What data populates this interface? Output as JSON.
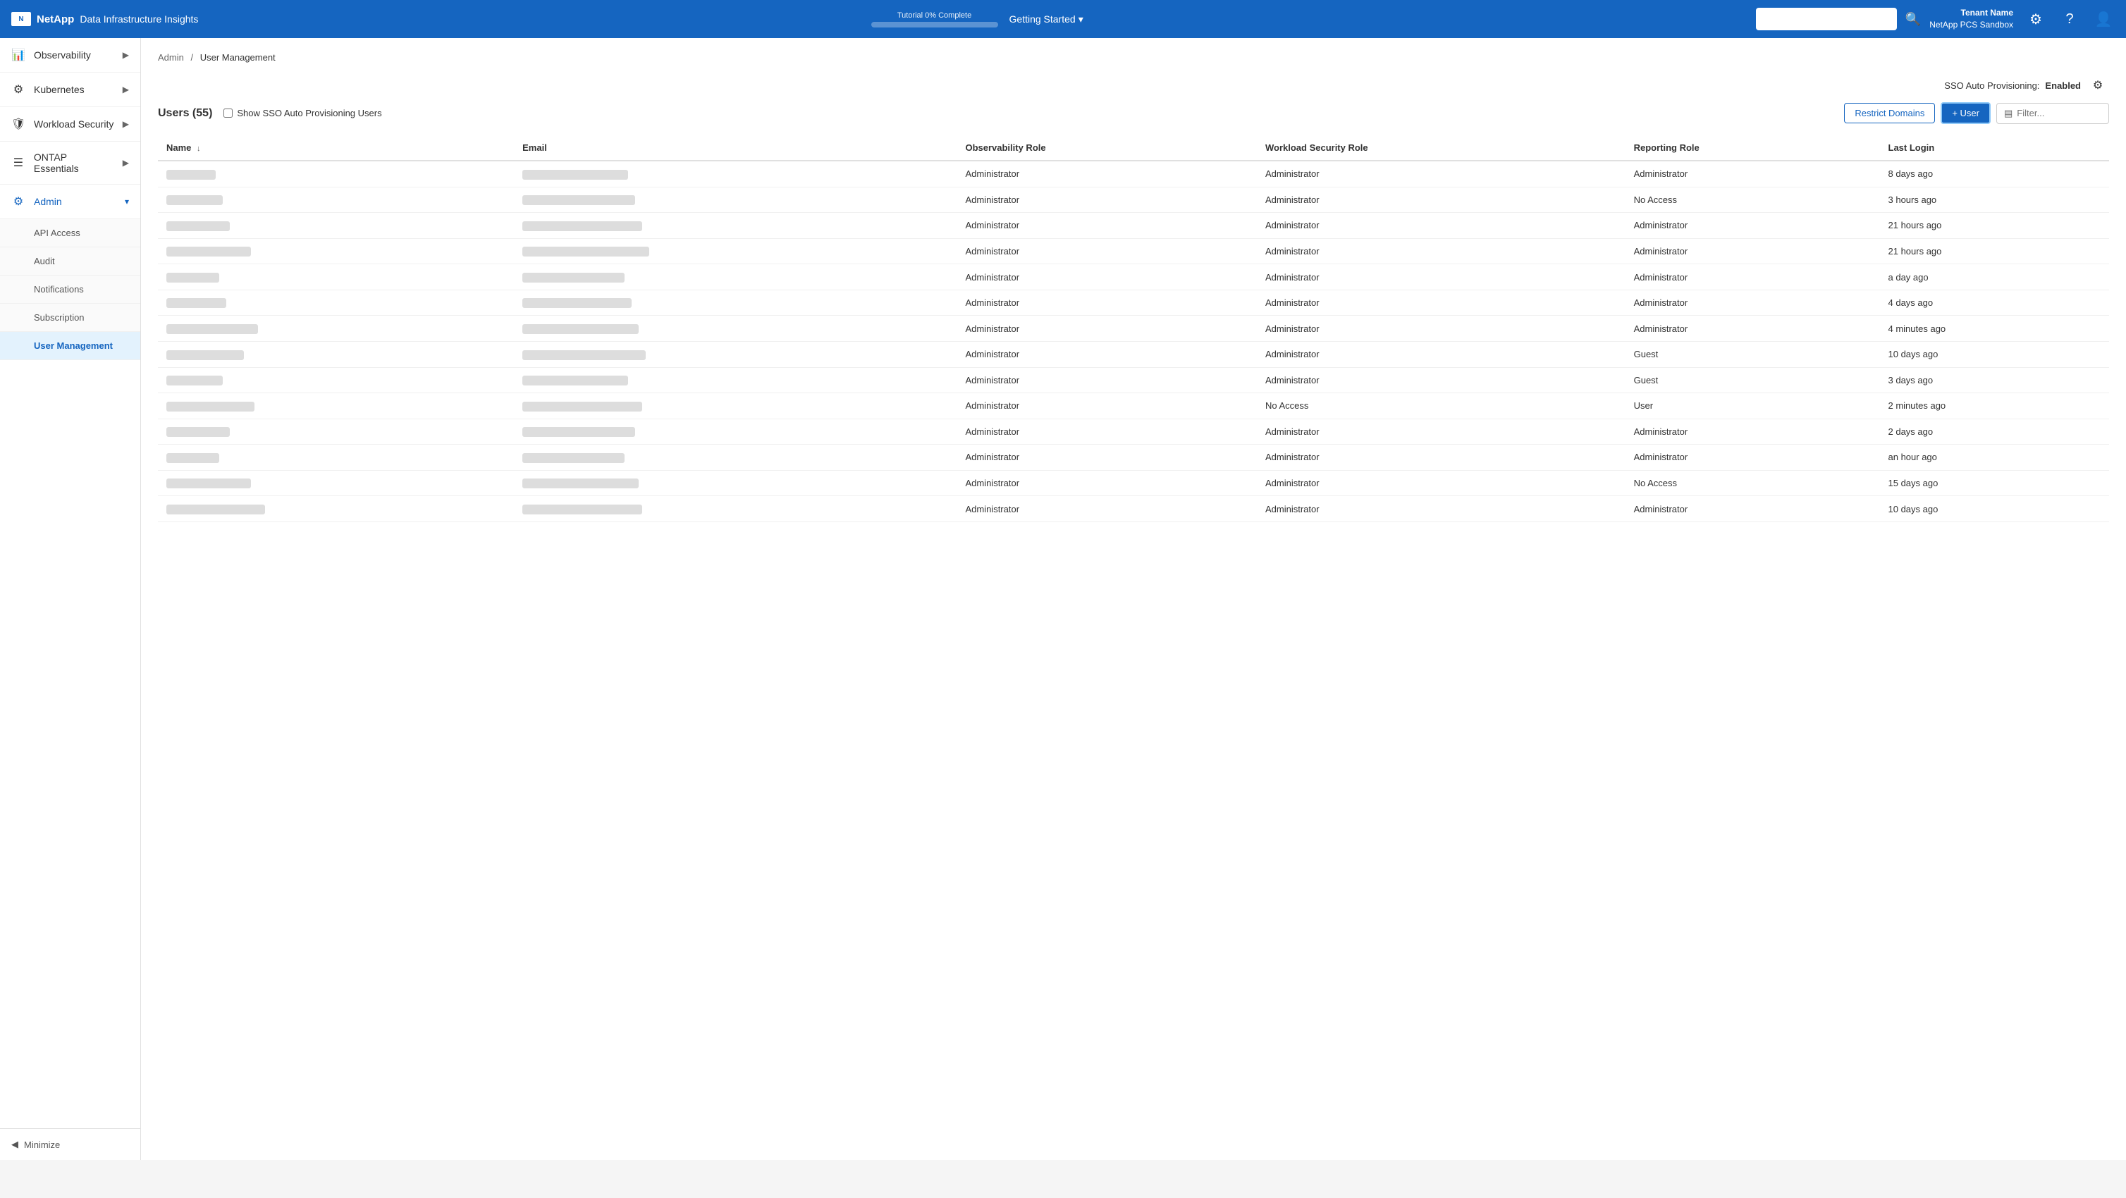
{
  "header": {
    "logo_text": "NetApp",
    "app_name": "Data Infrastructure Insights",
    "tutorial_label": "Tutorial 0% Complete",
    "tutorial_percent": 0,
    "getting_started": "Getting Started",
    "search_placeholder": "",
    "tenant_name": "Tenant Name",
    "tenant_sub": "NetApp PCS Sandbox"
  },
  "sidebar": {
    "items": [
      {
        "id": "observability",
        "label": "Observability",
        "icon": "📊",
        "has_sub": true
      },
      {
        "id": "kubernetes",
        "label": "Kubernetes",
        "icon": "⚙",
        "has_sub": true
      },
      {
        "id": "workload-security",
        "label": "Workload Security",
        "icon": "🛡",
        "has_sub": true
      },
      {
        "id": "ontap-essentials",
        "label": "ONTAP Essentials",
        "icon": "☰",
        "has_sub": true
      },
      {
        "id": "admin",
        "label": "Admin",
        "icon": "⚙",
        "has_sub": true,
        "active": true
      }
    ],
    "sub_items": [
      {
        "id": "api-access",
        "label": "API Access"
      },
      {
        "id": "audit",
        "label": "Audit"
      },
      {
        "id": "notifications",
        "label": "Notifications"
      },
      {
        "id": "subscription",
        "label": "Subscription"
      },
      {
        "id": "user-management",
        "label": "User Management",
        "active": true
      }
    ],
    "minimize": "Minimize"
  },
  "breadcrumb": {
    "parent": "Admin",
    "separator": "/",
    "current": "User Management"
  },
  "sso": {
    "label": "SSO Auto Provisioning:",
    "status": "Enabled",
    "settings_title": "SSO Settings"
  },
  "users_section": {
    "title": "Users",
    "count": 55,
    "show_sso_label": "Show SSO Auto Provisioning Users",
    "restrict_domains": "Restrict Domains",
    "add_user": "+ User",
    "filter_placeholder": "Filter..."
  },
  "table": {
    "columns": [
      "Name",
      "Email",
      "Observability Role",
      "Workload Security Role",
      "Reporting Role",
      "Last Login"
    ],
    "rows": [
      {
        "obs_role": "Administrator",
        "ws_role": "Administrator",
        "rep_role": "Administrator",
        "last_login": "8 days ago"
      },
      {
        "obs_role": "Administrator",
        "ws_role": "Administrator",
        "rep_role": "No Access",
        "last_login": "3 hours ago"
      },
      {
        "obs_role": "Administrator",
        "ws_role": "Administrator",
        "rep_role": "Administrator",
        "last_login": "21 hours ago"
      },
      {
        "obs_role": "Administrator",
        "ws_role": "Administrator",
        "rep_role": "Administrator",
        "last_login": "21 hours ago"
      },
      {
        "obs_role": "Administrator",
        "ws_role": "Administrator",
        "rep_role": "Administrator",
        "last_login": "a day ago"
      },
      {
        "obs_role": "Administrator",
        "ws_role": "Administrator",
        "rep_role": "Administrator",
        "last_login": "4 days ago"
      },
      {
        "obs_role": "Administrator",
        "ws_role": "Administrator",
        "rep_role": "Administrator",
        "last_login": "4 minutes ago"
      },
      {
        "obs_role": "Administrator",
        "ws_role": "Administrator",
        "rep_role": "Guest",
        "last_login": "10 days ago"
      },
      {
        "obs_role": "Administrator",
        "ws_role": "Administrator",
        "rep_role": "Guest",
        "last_login": "3 days ago"
      },
      {
        "obs_role": "Administrator",
        "ws_role": "No Access",
        "rep_role": "User",
        "last_login": "2 minutes ago"
      },
      {
        "obs_role": "Administrator",
        "ws_role": "Administrator",
        "rep_role": "Administrator",
        "last_login": "2 days ago"
      },
      {
        "obs_role": "Administrator",
        "ws_role": "Administrator",
        "rep_role": "Administrator",
        "last_login": "an hour ago"
      },
      {
        "obs_role": "Administrator",
        "ws_role": "Administrator",
        "rep_role": "No Access",
        "last_login": "15 days ago"
      },
      {
        "obs_role": "Administrator",
        "ws_role": "Administrator",
        "rep_role": "Administrator",
        "last_login": "10 days ago"
      }
    ],
    "blurred_name_widths": [
      70,
      80,
      90,
      120,
      75,
      85,
      130,
      110,
      80,
      125,
      90,
      75,
      120,
      140
    ],
    "blurred_email_widths": [
      150,
      160,
      170,
      180,
      145,
      155,
      165,
      175,
      150,
      170,
      160,
      145,
      165,
      170
    ]
  },
  "colors": {
    "primary": "#1565c0",
    "active_bg": "#e3f2fd",
    "header_bg": "#1565c0"
  }
}
